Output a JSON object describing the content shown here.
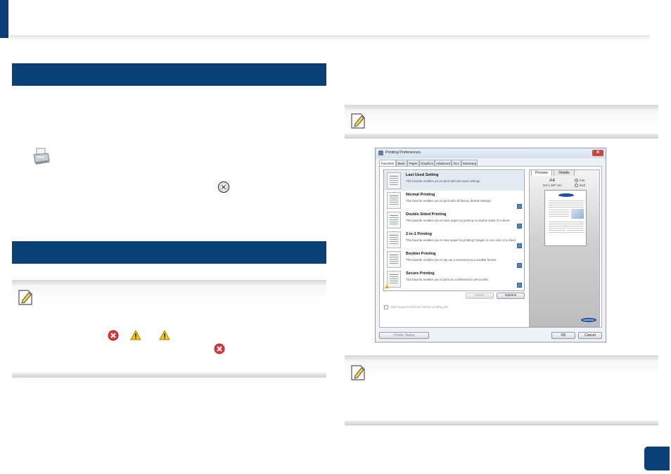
{
  "dialog": {
    "title": "Printing Preferences",
    "close_label": "✕",
    "tabs": [
      {
        "label": "Favorites",
        "active": true
      },
      {
        "label": "Basic"
      },
      {
        "label": "Paper"
      },
      {
        "label": "Graphics"
      },
      {
        "label": "Advanced"
      },
      {
        "label": "Eco"
      },
      {
        "label": "Samsung"
      }
    ],
    "favorites": [
      {
        "title": "Last Used Setting",
        "description": "This favorite enables you to print with last used settings.",
        "selected": true
      },
      {
        "title": "Normal Printing",
        "description": "This favorite enables you to print with all factory default settings."
      },
      {
        "title": "Double Sided Printing",
        "description": "This favorite enables you to save paper by printing on double sides of a sheet."
      },
      {
        "title": "2-in-1 Printing",
        "description": "This favorite enables you to save paper by printing 2 pages on one side of a sheet."
      },
      {
        "title": "Booklet Printing",
        "description": "This favorite enables you to lay out a document as a booklet format."
      },
      {
        "title": "Secure Printing",
        "description": "This favorite enables you to print as confidential in print mode."
      }
    ],
    "delete_label": "Delete",
    "options_label": "Options",
    "eco_checkbox_label": "Start Easy Eco Driver before printing job",
    "preview": {
      "tab_preview": "Preview",
      "tab_details": "Details",
      "paper_size": "A4",
      "paper_dims": "210 x 297 mm",
      "unit_mm": "mm",
      "unit_inch": "inch",
      "selected_unit": "mm",
      "brand": "SAMSUNG"
    },
    "printer_status_label": "Printer Status",
    "ok_label": "OK",
    "cancel_label": "Cancel"
  },
  "colors": {
    "brand_blue": "#0b3f78",
    "warning_yellow": "#e8b400",
    "error_red": "#e0383a"
  }
}
